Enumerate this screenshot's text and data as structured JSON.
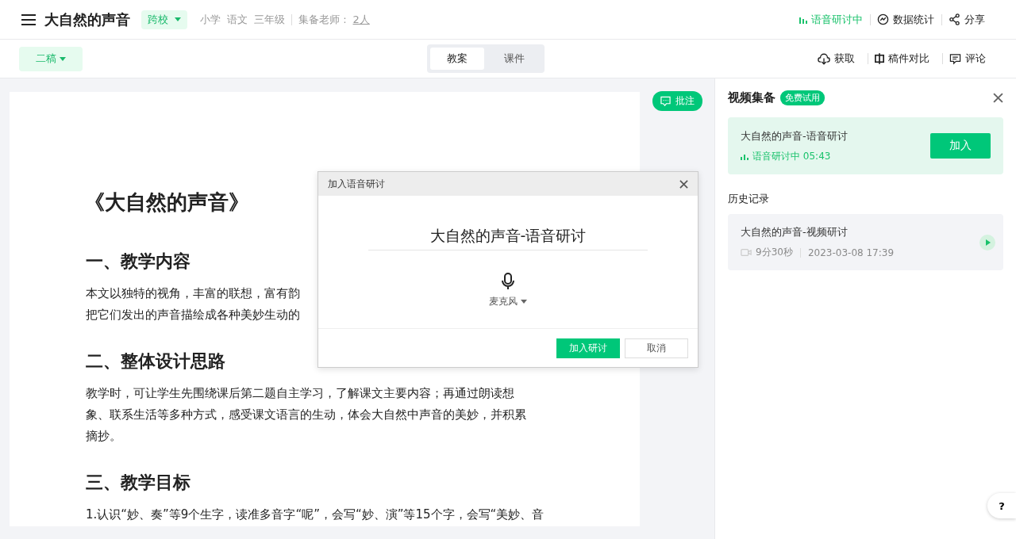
{
  "header": {
    "title": "大自然的声音",
    "school_tag": "跨校",
    "meta": [
      "小学",
      "语文",
      "三年级"
    ],
    "teachers_label": "集备老师 :",
    "teachers_link": "2人",
    "actions": [
      {
        "kind": "live",
        "label": "语音研讨中"
      },
      {
        "kind": "stats",
        "label": "数据统计"
      },
      {
        "kind": "share",
        "label": "分享"
      }
    ]
  },
  "toolbar": {
    "draft": "二稿",
    "tabs": [
      {
        "label": "教案",
        "selected": true
      },
      {
        "label": "课件",
        "selected": false
      }
    ],
    "actions": [
      {
        "kind": "download",
        "label": "获取"
      },
      {
        "kind": "compare",
        "label": "稿件对比"
      },
      {
        "kind": "comment",
        "label": "评论"
      }
    ]
  },
  "document": {
    "blocks": [
      {
        "kind": "title",
        "lines": [
          "《大自然的声音》"
        ]
      },
      {
        "kind": "heading",
        "lines": [
          "一、教学内容"
        ]
      },
      {
        "kind": "paragraph",
        "lines": [
          "本文以独特的视角，丰富的联想，富有韵",
          "把它们发出的声音描绘成各种美妙生动的"
        ]
      },
      {
        "kind": "heading",
        "lines": [
          "二、整体设计思路"
        ]
      },
      {
        "kind": "paragraph",
        "lines": [
          "教学时，可让学生先围绕课后第二题自主学习，了解课文主要内容；再通过朗读想",
          "象、联系生活等多种方式，感受课文语言的生动，体会大自然中声音的美妙，并积累",
          "摘抄。"
        ]
      },
      {
        "kind": "heading",
        "lines": [
          "三、教学目标"
        ]
      },
      {
        "kind": "paragraph",
        "lines": [
          "1.认识“妙、奏”等9个生字，读准多音字“呢”，会写“妙、演”等15个字，会写“美妙、音"
        ]
      }
    ]
  },
  "annotate_button": "批注",
  "panel": {
    "title": "视频集备",
    "badge": "免费试用",
    "live": {
      "title": "大自然的声音-语音研讨",
      "status": "语音研讨中 05:43",
      "button": "加入"
    },
    "history_label": "历史记录",
    "history": [
      {
        "title": "大自然的声音-视频研讨",
        "duration": "9分30秒",
        "date": "2023-03-08 17:39"
      }
    ]
  },
  "dialog": {
    "title": "加入语音研讨",
    "name_value": "大自然的声音-语音研讨",
    "device": "麦克风",
    "buttons": [
      {
        "kind": "primary",
        "label": "加入研讨"
      },
      {
        "kind": "secondary",
        "label": "取消"
      }
    ]
  },
  "help_button": "?"
}
